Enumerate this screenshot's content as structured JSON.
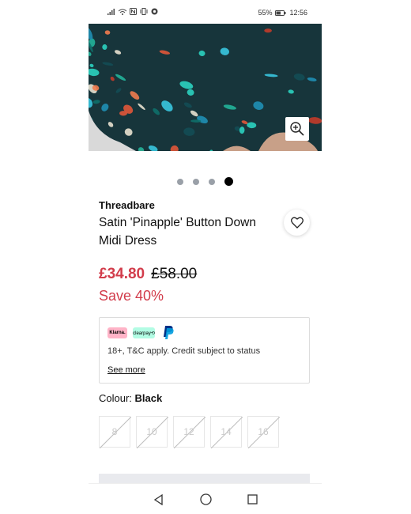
{
  "status_bar": {
    "battery": "55%",
    "time": "12:56"
  },
  "gallery": {
    "slide_count": 4,
    "active_slide": 4
  },
  "product": {
    "brand": "Threadbare",
    "name": "Satin 'Pinapple' Button Down Midi Dress",
    "price_now": "£34.80",
    "price_was": "£58.00",
    "saving": "Save 40%"
  },
  "payment": {
    "klarna_label": "Klarna.",
    "clearpay_label": "clearpay⟲",
    "terms": "18+, T&C apply. Credit subject to status",
    "see_more": "See more"
  },
  "colour": {
    "label": "Colour:",
    "value": "Black"
  },
  "sizes": [
    "8",
    "10",
    "12",
    "14",
    "16"
  ],
  "colors": {
    "sale_red": "#d23c4b",
    "text": "#111111",
    "border": "#dcdcdc"
  }
}
